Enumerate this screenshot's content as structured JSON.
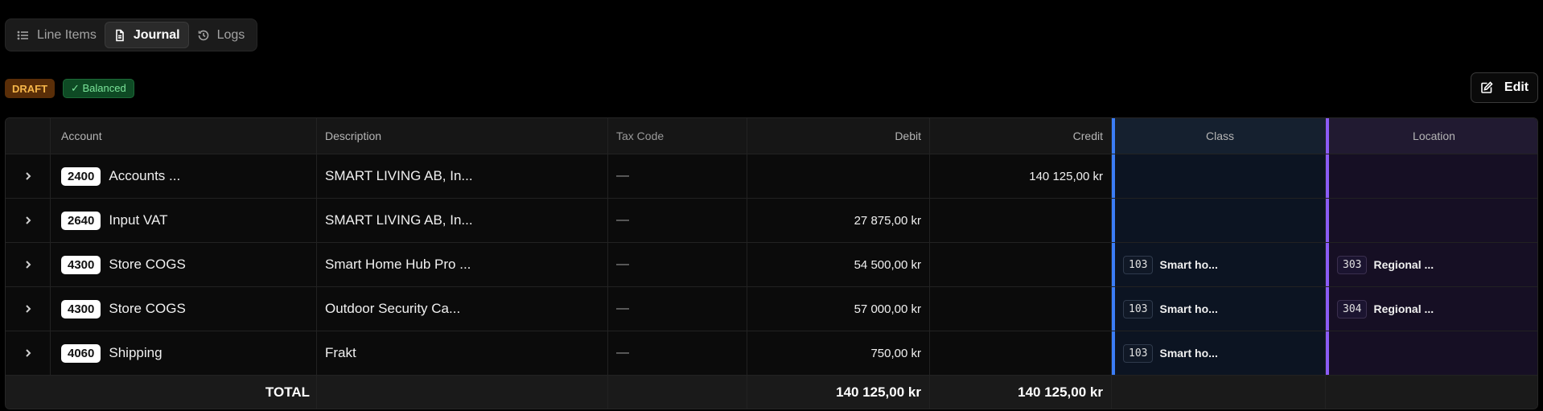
{
  "tabs": [
    {
      "label": "Line Items",
      "icon": "list-icon"
    },
    {
      "label": "Journal",
      "icon": "document-icon",
      "active": true
    },
    {
      "label": "Logs",
      "icon": "history-icon"
    }
  ],
  "status": {
    "draft": "DRAFT",
    "balanced": "✓ Balanced"
  },
  "edit_label": "Edit",
  "colors": {
    "class_accent": "#3b7df6",
    "location_accent": "#8b5cf6",
    "draft": "#f5b64a",
    "balanced": "#7be59a"
  },
  "table": {
    "headers": {
      "account": "Account",
      "description": "Description",
      "tax_code": "Tax Code",
      "debit": "Debit",
      "credit": "Credit",
      "class": "Class",
      "location": "Location"
    },
    "rows": [
      {
        "code": "2400",
        "account": "Accounts ...",
        "description": "SMART LIVING AB, In...",
        "tax": "—",
        "debit": "",
        "credit": "140 125,00 kr",
        "class_code": "",
        "class_label": "",
        "loc_code": "",
        "loc_label": ""
      },
      {
        "code": "2640",
        "account": "Input VAT",
        "description": "SMART LIVING AB, In...",
        "tax": "—",
        "debit": "27 875,00 kr",
        "credit": "",
        "class_code": "",
        "class_label": "",
        "loc_code": "",
        "loc_label": ""
      },
      {
        "code": "4300",
        "account": "Store COGS",
        "description": "Smart Home Hub Pro ...",
        "tax": "—",
        "debit": "54 500,00 kr",
        "credit": "",
        "class_code": "103",
        "class_label": "Smart ho...",
        "loc_code": "303",
        "loc_label": "Regional ..."
      },
      {
        "code": "4300",
        "account": "Store COGS",
        "description": "Outdoor Security Ca...",
        "tax": "—",
        "debit": "57 000,00 kr",
        "credit": "",
        "class_code": "103",
        "class_label": "Smart ho...",
        "loc_code": "304",
        "loc_label": "Regional ..."
      },
      {
        "code": "4060",
        "account": "Shipping",
        "description": "Frakt",
        "tax": "—",
        "debit": "750,00 kr",
        "credit": "",
        "class_code": "103",
        "class_label": "Smart ho...",
        "loc_code": "",
        "loc_label": ""
      }
    ],
    "total": {
      "label": "TOTAL",
      "debit": "140 125,00 kr",
      "credit": "140 125,00 kr"
    }
  }
}
